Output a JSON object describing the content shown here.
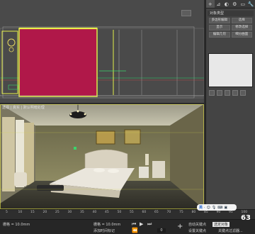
{
  "viewports": {
    "top_label": "",
    "persp_label": "透视 | 真实 | 默认明暗处理"
  },
  "command_panel": {
    "tabs": [
      "+",
      "⊿",
      "◐",
      "⚙",
      "▭",
      "🔧"
    ],
    "section_title": "对象类型",
    "buttons": [
      {
        "label": "多边形编辑"
      },
      {
        "label": "选择"
      },
      {
        "label": "显示"
      },
      {
        "label": "修改选择"
      },
      {
        "label": "编辑几何"
      },
      {
        "label": "细分曲面"
      }
    ]
  },
  "timeline": {
    "ticks": [
      "5",
      "10",
      "15",
      "20",
      "25",
      "30",
      "35",
      "40",
      "45",
      "50",
      "55",
      "60",
      "65",
      "70",
      "75",
      "80",
      "85",
      "90",
      "95",
      "100"
    ]
  },
  "status": {
    "grid": "栅格 = 10.0mm",
    "add_time_tag": "添加时间标记",
    "auto_key": "自动关键点",
    "selected": "选定对象",
    "set_key": "设置关键点",
    "key_filters": "关键点过滤器...",
    "frame": "0"
  },
  "ime": {
    "label": "英"
  },
  "badge": "63",
  "colors": {
    "wall_fill": "#b01849",
    "wall_edge": "#d4e34a",
    "accent_blue": "#2a6bd1"
  }
}
